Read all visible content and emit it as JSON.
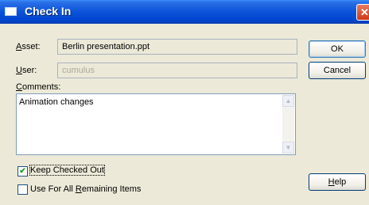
{
  "window": {
    "title": "Check In",
    "close_glyph": "✕"
  },
  "asset": {
    "label_u": "A",
    "label_rest": "sset:",
    "value": "Berlin presentation.ppt"
  },
  "user": {
    "label_u": "U",
    "label_rest": "ser:",
    "value": "cumulus"
  },
  "comments": {
    "label_u": "C",
    "label_rest": "omments:",
    "value": "Animation changes"
  },
  "options": {
    "keep_checked_out": {
      "label": "Keep Checked Out",
      "checked": true
    },
    "use_for_all_a": "Use For All ",
    "use_for_all_u": "R",
    "use_for_all_b": "emaining Items"
  },
  "buttons": {
    "ok": "OK",
    "cancel": "Cancel",
    "help_u": "H",
    "help_rest": "elp"
  },
  "icons": {
    "checkmark": "✔",
    "scroll_up": "▲",
    "scroll_down": "▼"
  }
}
